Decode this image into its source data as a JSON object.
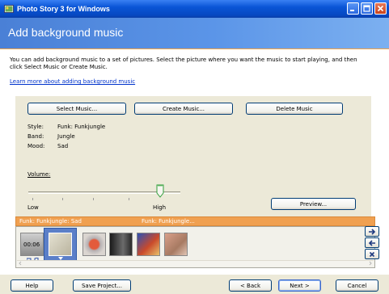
{
  "window": {
    "title": "Photo Story 3 for Windows"
  },
  "header": {
    "title": "Add background music"
  },
  "instructions": {
    "line1": "You can add background music to a set of pictures.  Select the picture where you want the music to start playing, and then",
    "line2": "click Select Music or Create Music.",
    "learn_link": "Learn more about adding background music"
  },
  "music_buttons": {
    "select": "Select Music...",
    "create": "Create Music...",
    "delete": "Delete Music"
  },
  "properties": [
    {
      "label": "Style:",
      "value": "Funk: Funkjungle"
    },
    {
      "label": "Band:",
      "value": "Jungle"
    },
    {
      "label": "Mood:",
      "value": "Sad"
    }
  ],
  "volume": {
    "label": "Volume:",
    "low": "Low",
    "high": "High",
    "level": 0.9
  },
  "preview_button": "Preview...",
  "timeline": {
    "tracks": [
      "Funk: Funkjungle: Sad",
      "Funk: Funkjungle..."
    ],
    "duration": "00:06"
  },
  "footer": {
    "help": "Help",
    "save": "Save Project...",
    "back": "< Back",
    "next": "Next >",
    "cancel": "Cancel"
  },
  "colors": {
    "title_bar": "#0a55d6",
    "header": "#5b95e8",
    "timeline_track": "#f0a050",
    "accent_line": "#f0a24a"
  }
}
